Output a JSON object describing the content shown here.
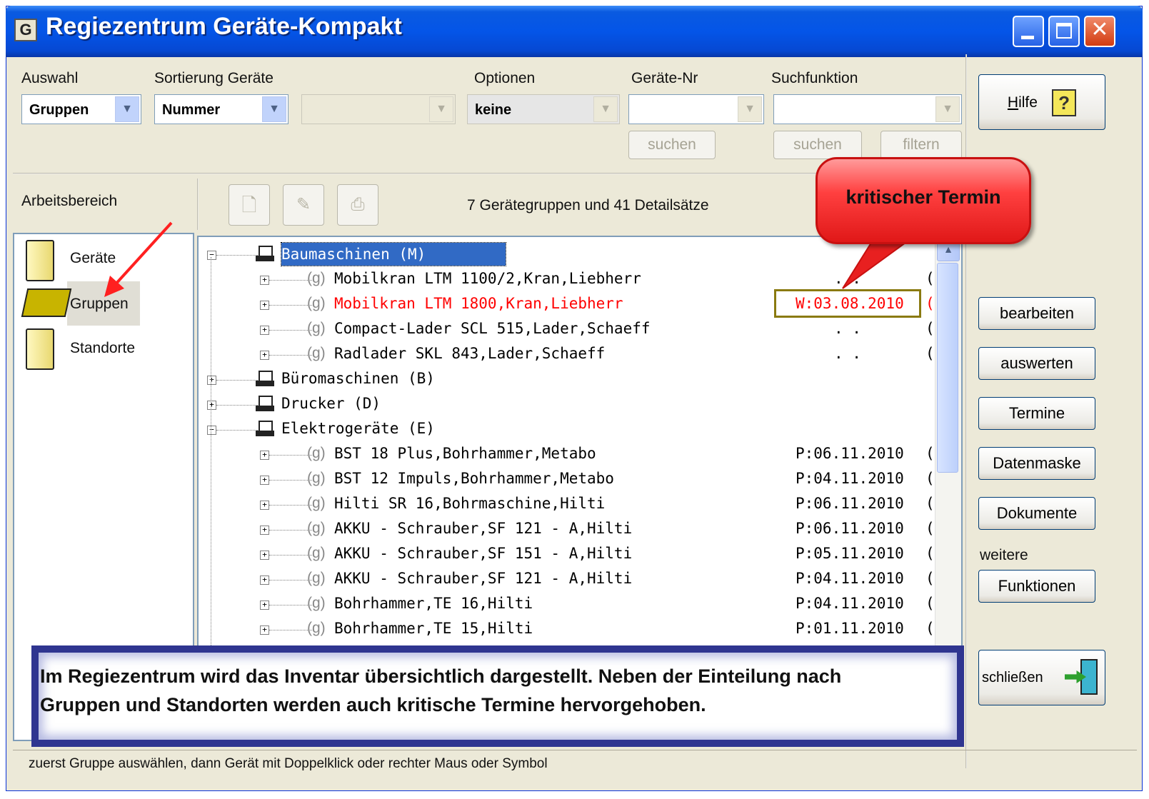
{
  "window": {
    "title": "Regiezentrum Geräte-Kompakt",
    "app_icon_text": "G"
  },
  "toolbar": {
    "auswahl": {
      "label": "Auswahl",
      "value": "Gruppen"
    },
    "sortierung": {
      "label": "Sortierung Geräte",
      "value": "Nummer"
    },
    "optionen": {
      "label": "Optionen",
      "value": "keine"
    },
    "geraete_nr": {
      "label": "Geräte-Nr",
      "value": "",
      "search_button": "suchen"
    },
    "suchfunktion": {
      "label": "Suchfunktion",
      "value": "",
      "search_button": "suchen",
      "filter_button": "filtern"
    }
  },
  "workspace": {
    "label": "Arbeitsbereich",
    "items": [
      {
        "label": "Geräte",
        "icon": "folder-icon"
      },
      {
        "label": "Gruppen",
        "icon": "open-folder-icon",
        "selected": true
      },
      {
        "label": "Standorte",
        "icon": "folder-icon"
      }
    ]
  },
  "list_toolbar": {
    "count_text": "7 Gerätegruppen und 41 Detailsätze"
  },
  "tree": {
    "rows": [
      {
        "level": 0,
        "expander": "−",
        "text": "Baumaschinen   (M)",
        "selected": true,
        "date": "",
        "tail": ""
      },
      {
        "level": 1,
        "expander": "+",
        "prefix": "(g)",
        "text": "Mobilkran  LTM 1100/2,Kran,Liebherr",
        "date": ". .",
        "tail": "("
      },
      {
        "level": 1,
        "expander": "+",
        "prefix": "(g)",
        "text": "Mobilkran LTM 1800,Kran,Liebherr",
        "date": "W:03.08.2010",
        "tail": "(",
        "critical": true
      },
      {
        "level": 1,
        "expander": "+",
        "prefix": "(g)",
        "text": "Compact-Lader SCL 515,Lader,Schaeff",
        "date": ". .",
        "tail": "("
      },
      {
        "level": 1,
        "expander": "+",
        "prefix": "(g)",
        "text": "Radlader SKL 843,Lader,Schaeff",
        "date": ". .",
        "tail": "("
      },
      {
        "level": 0,
        "expander": "+",
        "text": "Büromaschinen (B)",
        "date": "",
        "tail": ""
      },
      {
        "level": 0,
        "expander": "+",
        "text": "Drucker  (D)",
        "date": "",
        "tail": ""
      },
      {
        "level": 0,
        "expander": "−",
        "text": "Elektrogeräte (E)",
        "date": "",
        "tail": ""
      },
      {
        "level": 1,
        "expander": "+",
        "prefix": "(g)",
        "text": "BST 18 Plus,Bohrhammer,Metabo",
        "date": "P:06.11.2010",
        "tail": "("
      },
      {
        "level": 1,
        "expander": "+",
        "prefix": "(g)",
        "text": "BST 12  Impuls,Bohrhammer,Metabo",
        "date": "P:04.11.2010",
        "tail": "("
      },
      {
        "level": 1,
        "expander": "+",
        "prefix": "(g)",
        "text": "Hilti SR 16,Bohrmaschine,Hilti",
        "date": "P:06.11.2010",
        "tail": "("
      },
      {
        "level": 1,
        "expander": "+",
        "prefix": "(g)",
        "text": "AKKU - Schrauber,SF 121 - A,Hilti",
        "date": "P:06.11.2010",
        "tail": "("
      },
      {
        "level": 1,
        "expander": "+",
        "prefix": "(g)",
        "text": "AKKU - Schrauber,SF 151 - A,Hilti",
        "date": "P:05.11.2010",
        "tail": "("
      },
      {
        "level": 1,
        "expander": "+",
        "prefix": "(g)",
        "text": "AKKU - Schrauber,SF 121 - A,Hilti",
        "date": "P:04.11.2010",
        "tail": "("
      },
      {
        "level": 1,
        "expander": "+",
        "prefix": "(g)",
        "text": "Bohrhammer,TE 16,Hilti",
        "date": "P:04.11.2010",
        "tail": "("
      },
      {
        "level": 1,
        "expander": "+",
        "prefix": "(g)",
        "text": "Bohrhammer,TE 15,Hilti",
        "date": "P:01.11.2010",
        "tail": "("
      }
    ]
  },
  "right_panel": {
    "help_label": "Hilfe",
    "help_mnemonic": "H",
    "buttons": [
      "bearbeiten",
      "auswerten",
      "Termine",
      "Datenmaske",
      "Dokumente"
    ],
    "weitere_label": "weitere",
    "funktionen_label": "Funktionen",
    "close_label": "schließen"
  },
  "callout": {
    "text": "kritischer Termin"
  },
  "info_banner": {
    "line1": "Im Regiezentrum wird das Inventar übersichtlich dargestellt. Neben der Einteilung nach",
    "line2": "Gruppen und Standorten werden auch kritische Termine hervorgehoben."
  },
  "status_bar": {
    "text": "zuerst Gruppe auswählen, dann Gerät mit Doppelklick oder rechter Maus oder Symbol"
  },
  "colors": {
    "critical": "#ff0000",
    "selection": "#316ac5",
    "title_bar": "#0455e8",
    "callout": "#ff3030",
    "banner": "#2f3590"
  }
}
